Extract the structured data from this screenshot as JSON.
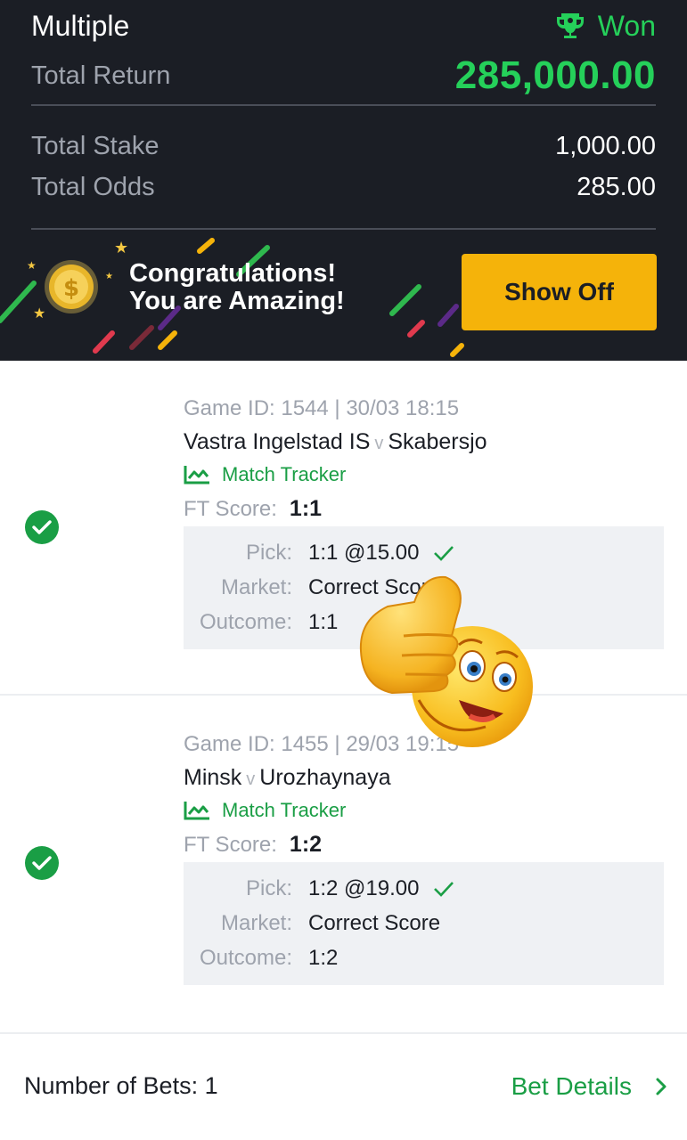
{
  "summary": {
    "bet_type": "Multiple",
    "status": "Won",
    "total_return_label": "Total Return",
    "total_return": "285,000.00",
    "total_stake_label": "Total Stake",
    "total_stake": "1,000.00",
    "total_odds_label": "Total Odds",
    "total_odds": "285.00",
    "won_color": "#25d05a"
  },
  "banner": {
    "line1": "Congratulations!",
    "line2": "You are Amazing!",
    "show_off_label": "Show Off",
    "button_color": "#f5b30a"
  },
  "selections": [
    {
      "game_id": "Game ID: 1544 | 30/03 18:15",
      "home": "Vastra Ingelstad IS",
      "vs": "v",
      "away": "Skabersjo",
      "tracker_label": "Match Tracker",
      "ft_label": "FT Score:",
      "ft_score": "1:1",
      "pick_label": "Pick:",
      "pick": "1:1 @15.00",
      "market_label": "Market:",
      "market": "Correct Score",
      "outcome_label": "Outcome:",
      "outcome": "1:1"
    },
    {
      "game_id": "Game ID: 1455 | 29/03 19:15",
      "home": "Minsk",
      "vs": "v",
      "away": "Urozhaynaya",
      "tracker_label": "Match Tracker",
      "ft_label": "FT Score:",
      "ft_score": "1:2",
      "pick_label": "Pick:",
      "pick": "1:2 @19.00",
      "market_label": "Market:",
      "market": "Correct Score",
      "outcome_label": "Outcome:",
      "outcome": "1:2"
    }
  ],
  "footer": {
    "number_of_bets": "Number of Bets: 1",
    "bet_details_label": "Bet Details"
  },
  "icons": [
    "trophy-icon",
    "coin-icon",
    "check-circle-icon",
    "chart-line-icon",
    "checkmark-icon",
    "chevron-right-icon",
    "thumbs-up-emoji"
  ]
}
